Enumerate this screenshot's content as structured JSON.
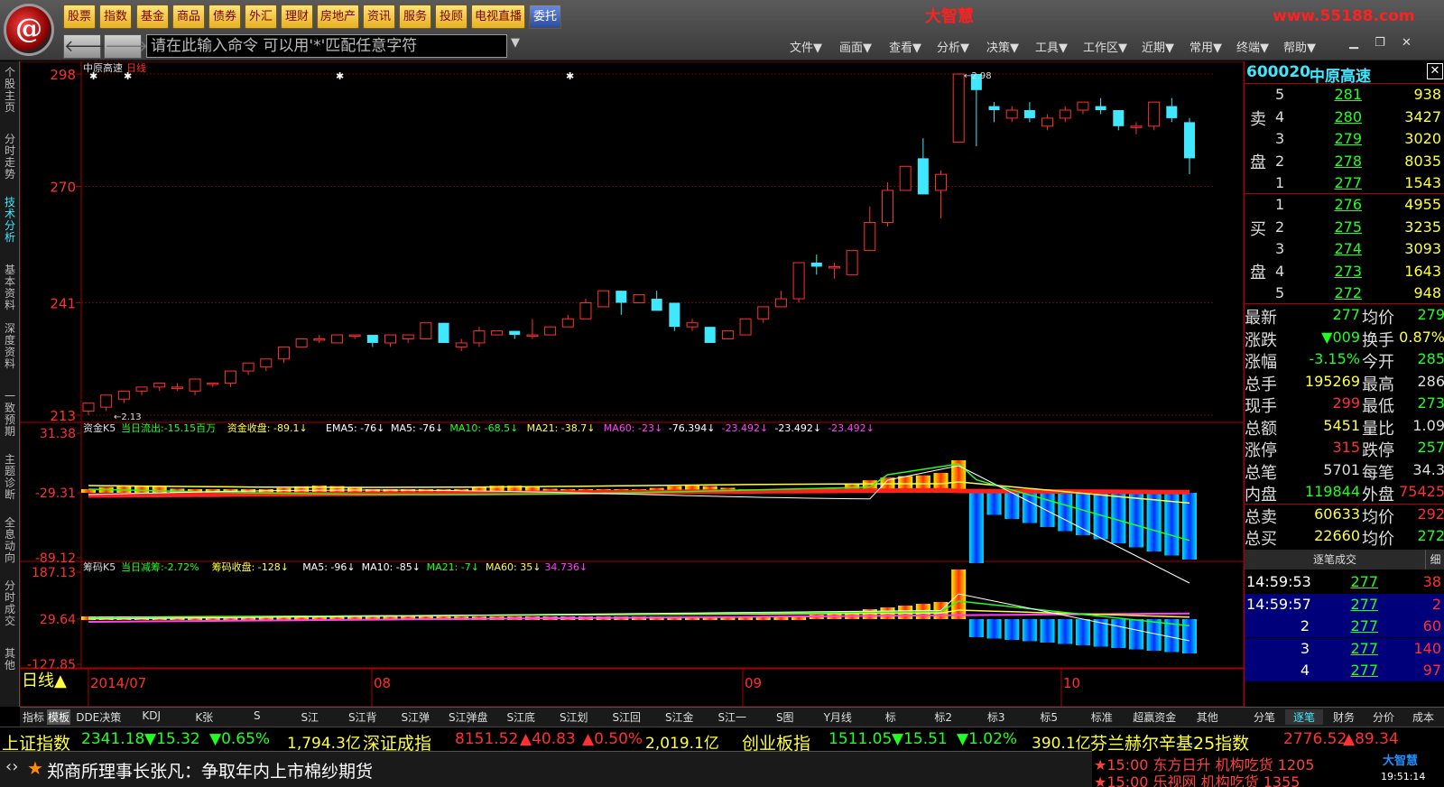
{
  "nav_buttons": [
    "股票",
    "指数",
    "基金",
    "商品",
    "债券",
    "外汇",
    "理财",
    "房地产",
    "资讯",
    "服务",
    "投顾",
    "电视直播",
    "委托"
  ],
  "brand": "大智慧",
  "brand_url": "www.55188.com",
  "command_placeholder": "请在此输入命令   可以用'*'匹配任意字符",
  "menus": [
    "文件▼",
    "画面▼",
    "查看▼",
    "分析▼",
    "决策▼",
    "工具▼",
    "工作区▼",
    "近期▼",
    "常用▼",
    "终端▼",
    "帮助▼"
  ],
  "left_tabs": [
    "个股主页",
    "分时走势",
    "技术分析",
    "基本资料",
    "深度资料",
    "一致预期",
    "主题诊断",
    "全息动向",
    "分时成交",
    "其他"
  ],
  "chart_data": [
    {
      "type": "candlestick",
      "title": "中原高速",
      "period": "日线",
      "y_ticks": [
        "298",
        "270",
        "241",
        "213"
      ],
      "ylim": [
        213,
        298
      ],
      "x_labels": [
        "2014/07",
        "08",
        "09",
        "10"
      ],
      "annotations": [
        "2.13",
        "2.98"
      ],
      "candles": [
        [
          2.14,
          2.16,
          2.13,
          2.16
        ],
        [
          2.15,
          2.18,
          2.14,
          2.18
        ],
        [
          2.17,
          2.19,
          2.16,
          2.19
        ],
        [
          2.19,
          2.2,
          2.18,
          2.2
        ],
        [
          2.2,
          2.21,
          2.19,
          2.21
        ],
        [
          2.2,
          2.21,
          2.19,
          2.2
        ],
        [
          2.19,
          2.22,
          2.18,
          2.22
        ],
        [
          2.21,
          2.21,
          2.2,
          2.21
        ],
        [
          2.21,
          2.24,
          2.2,
          2.24
        ],
        [
          2.24,
          2.26,
          2.23,
          2.26
        ],
        [
          2.25,
          2.27,
          2.24,
          2.27
        ],
        [
          2.27,
          2.3,
          2.26,
          2.3
        ],
        [
          2.3,
          2.32,
          2.3,
          2.32
        ],
        [
          2.32,
          2.33,
          2.31,
          2.32
        ],
        [
          2.31,
          2.33,
          2.31,
          2.33
        ],
        [
          2.33,
          2.33,
          2.32,
          2.33
        ],
        [
          2.33,
          2.33,
          2.3,
          2.31
        ],
        [
          2.31,
          2.33,
          2.3,
          2.33
        ],
        [
          2.32,
          2.33,
          2.31,
          2.33
        ],
        [
          2.32,
          2.36,
          2.32,
          2.36
        ],
        [
          2.36,
          2.36,
          2.31,
          2.31
        ],
        [
          2.3,
          2.32,
          2.29,
          2.31
        ],
        [
          2.31,
          2.35,
          2.3,
          2.34
        ],
        [
          2.33,
          2.34,
          2.33,
          2.34
        ],
        [
          2.34,
          2.34,
          2.32,
          2.33
        ],
        [
          2.33,
          2.37,
          2.32,
          2.33
        ],
        [
          2.33,
          2.35,
          2.33,
          2.35
        ],
        [
          2.35,
          2.38,
          2.35,
          2.37
        ],
        [
          2.37,
          2.42,
          2.37,
          2.41
        ],
        [
          2.4,
          2.44,
          2.4,
          2.44
        ],
        [
          2.44,
          2.44,
          2.38,
          2.41
        ],
        [
          2.41,
          2.43,
          2.41,
          2.43
        ],
        [
          2.42,
          2.44,
          2.39,
          2.39
        ],
        [
          2.41,
          2.41,
          2.34,
          2.35
        ],
        [
          2.35,
          2.37,
          2.34,
          2.36
        ],
        [
          2.35,
          2.35,
          2.31,
          2.31
        ],
        [
          2.32,
          2.34,
          2.32,
          2.34
        ],
        [
          2.33,
          2.37,
          2.33,
          2.37
        ],
        [
          2.37,
          2.4,
          2.36,
          2.4
        ],
        [
          2.4,
          2.44,
          2.4,
          2.42
        ],
        [
          2.42,
          2.51,
          2.41,
          2.51
        ],
        [
          2.51,
          2.53,
          2.48,
          2.5
        ],
        [
          2.5,
          2.51,
          2.47,
          2.5
        ],
        [
          2.48,
          2.54,
          2.48,
          2.54
        ],
        [
          2.54,
          2.65,
          2.54,
          2.61
        ],
        [
          2.61,
          2.71,
          2.6,
          2.69
        ],
        [
          2.69,
          2.75,
          2.69,
          2.75
        ],
        [
          2.77,
          2.82,
          2.69,
          2.68
        ],
        [
          2.69,
          2.74,
          2.62,
          2.73
        ],
        [
          2.81,
          2.98,
          2.81,
          2.98
        ],
        [
          2.98,
          2.98,
          2.8,
          2.94
        ],
        [
          2.9,
          2.91,
          2.86,
          2.89
        ],
        [
          2.87,
          2.9,
          2.86,
          2.89
        ],
        [
          2.89,
          2.91,
          2.86,
          2.87
        ],
        [
          2.85,
          2.88,
          2.84,
          2.87
        ],
        [
          2.87,
          2.9,
          2.86,
          2.89
        ],
        [
          2.89,
          2.91,
          2.88,
          2.91
        ],
        [
          2.9,
          2.92,
          2.88,
          2.89
        ],
        [
          2.89,
          2.89,
          2.84,
          2.85
        ],
        [
          2.85,
          2.86,
          2.83,
          2.85
        ],
        [
          2.85,
          2.91,
          2.84,
          2.91
        ],
        [
          2.9,
          2.92,
          2.86,
          2.87
        ],
        [
          2.86,
          2.87,
          2.73,
          2.77
        ]
      ]
    },
    {
      "type": "bar-line",
      "title": "资金K5",
      "y_ticks": [
        "31.38",
        "-29.31",
        "-89.12"
      ],
      "legend": [
        "当日流出:-15.15百万",
        "资金收盘: -89.1↓",
        "EMA5: -76↓",
        "MA5: -76↓",
        "MA10: -68.5↓",
        "MA21: -38.7↓",
        "MA60: -23↓",
        "-76.394↓",
        "-23.492↓",
        "-23.492↓",
        "-23.492↓"
      ]
    },
    {
      "type": "bar-line",
      "title": "筹码K5",
      "y_ticks": [
        "187.13",
        "29.64",
        "-127.85"
      ],
      "legend": [
        "当日减筹:-2.72%",
        "筹码收盘: -128↓",
        "MA5: -96↓",
        "MA10: -85↓",
        "MA21: -7↓",
        "MA60: 35↓",
        "34.736↓"
      ]
    }
  ],
  "quote": {
    "code": "600020",
    "name": "中原高速",
    "sell_label": [
      "卖",
      "盘"
    ],
    "buy_label": [
      "买",
      "盘"
    ],
    "sell": [
      [
        "5",
        "281",
        "938"
      ],
      [
        "4",
        "280",
        "3427"
      ],
      [
        "3",
        "279",
        "3020"
      ],
      [
        "2",
        "278",
        "8035"
      ],
      [
        "1",
        "277",
        "1543"
      ]
    ],
    "buy": [
      [
        "1",
        "276",
        "4955"
      ],
      [
        "2",
        "275",
        "3235"
      ],
      [
        "3",
        "274",
        "3093"
      ],
      [
        "4",
        "273",
        "1643"
      ],
      [
        "5",
        "272",
        "948"
      ]
    ],
    "stats": [
      [
        "最新",
        "277",
        "均价",
        "279"
      ],
      [
        "涨跌",
        "▼009",
        "换手",
        "0.87%"
      ],
      [
        "涨幅",
        "-3.15%",
        "今开",
        "285"
      ],
      [
        "总手",
        "195269",
        "最高",
        "286"
      ],
      [
        "现手",
        "299",
        "最低",
        "273"
      ],
      [
        "总额",
        "5451",
        "量比",
        "1.09"
      ],
      [
        "涨停",
        "315",
        "跌停",
        "257"
      ],
      [
        "总笔",
        "5701",
        "每笔",
        "34.3"
      ],
      [
        "内盘",
        "119844",
        "外盘",
        "75425"
      ],
      [
        "总卖",
        "60633",
        "均价",
        "292"
      ],
      [
        "总买",
        "22660",
        "均价",
        "272"
      ]
    ],
    "trades_header": "逐笔成交",
    "trades_toggle": "细",
    "trades": [
      [
        "14:59:53",
        "277",
        "38"
      ],
      [
        "14:59:57",
        "277",
        "2"
      ],
      [
        "2",
        "277",
        "60"
      ],
      [
        "3",
        "277",
        "140"
      ],
      [
        "4",
        "277",
        "97"
      ]
    ]
  },
  "period_label": "日线▲",
  "bottom_tabs": [
    "指标",
    "模板",
    "DDE决策",
    "KDJ",
    "K张",
    "S",
    "S江",
    "S江背",
    "S江弹",
    "S江弹盘",
    "S江底",
    "S江划",
    "S江回",
    "S江金",
    "S江一",
    "S图",
    "Y月线",
    "标",
    "标2",
    "标3",
    "标5",
    "标准",
    "超赢资金",
    "其他"
  ],
  "right_tabs": [
    "分笔",
    "逐笔",
    "财务",
    "分价",
    "成本"
  ],
  "ticker": [
    {
      "name": "上证指数",
      "v": "2341.18",
      "c": "▼15.32",
      "p": "▼0.65%",
      "a": "1,794.3亿"
    },
    {
      "name": "深证成指",
      "v": "8151.52",
      "c": "▲40.83",
      "p": "▲0.50%",
      "a": "2,019.1亿"
    },
    {
      "name": "创业板指",
      "v": "1511.05",
      "c": "▼15.51",
      "p": "▼1.02%",
      "a": "390.1亿"
    },
    {
      "name": "芬兰赫尔辛基25指数",
      "v": "2776.52",
      "c": "▲89.34",
      "p": "",
      "a": ""
    }
  ],
  "news": "郑商所理事长张凡：争取年内上市棉纱期货",
  "news_right": [
    "★15:00 东方日升 机构吃货 1205",
    "★15:00 乐视网 机构吃货 1355"
  ],
  "clock": "19:51:14",
  "brand_small": "大智慧",
  "colors": {
    "up": "#ff3030",
    "down": "#40e8ff",
    "bg": "#000000",
    "grid": "#8a0000",
    "yellow": "#ffff40",
    "green": "#20ff20"
  }
}
